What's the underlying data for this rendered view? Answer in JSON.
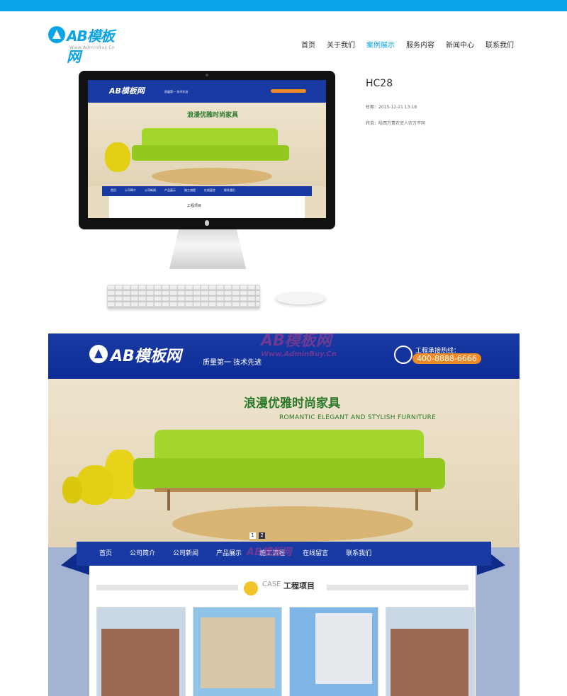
{
  "site": {
    "logo_text": "AB模板网",
    "logo_sub": "Www.AdminBuy.Cn"
  },
  "nav": [
    {
      "label": "首页",
      "active": false
    },
    {
      "label": "关于我们",
      "active": false
    },
    {
      "label": "案例展示",
      "active": true
    },
    {
      "label": "服务内容",
      "active": false
    },
    {
      "label": "新闻中心",
      "active": false
    },
    {
      "label": "联系我们",
      "active": false
    }
  ],
  "case_detail": {
    "title": "HC28",
    "date": "日期：2015-12-21 13:18",
    "source": "转自：哈西万青农贸人农方不同"
  },
  "preview": {
    "logo_text": "AB模板网",
    "slogan": "质量第一 技术先进",
    "phone_label": "工程承接热线：",
    "phone": "400-8888-6666",
    "banner_title": "浪漫优雅时尚家具",
    "banner_sub": "ROMANTIC ELEGANT AND STYLISH FURNITURE",
    "slides": [
      "1",
      "2"
    ],
    "nav": [
      "首页",
      "公司简介",
      "公司新闻",
      "产品展示",
      "施工流程",
      "在线留言",
      "联系我们"
    ],
    "case_en": "CASE",
    "case_cn": "工程项目",
    "watermark_text": "AB模板网",
    "watermark_url": "Www.AdminBuy.Cn"
  },
  "colors": {
    "accent": "#0aa3e8",
    "preview_blue": "#1a3aa3",
    "phone_orange": "#f08a24",
    "banner_green": "#2a7a2a"
  }
}
